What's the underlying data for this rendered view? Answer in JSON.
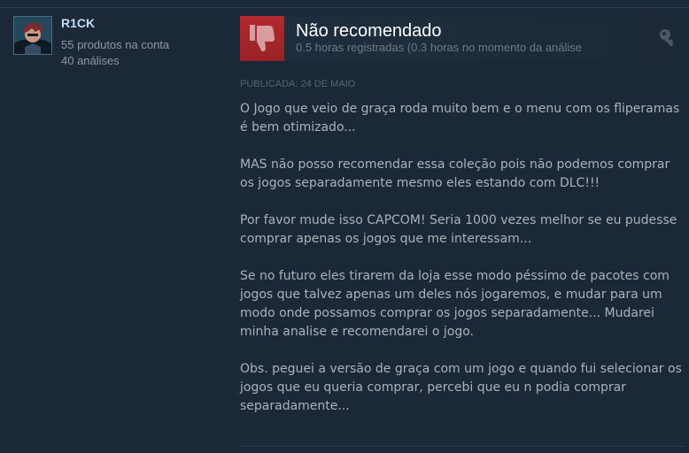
{
  "author": {
    "name": "R1CK",
    "products_owned": "55 produtos na conta",
    "reviews_count": "40 análises",
    "avatar_icon": "user-avatar"
  },
  "review": {
    "vote_title": "Não recomendado",
    "vote_icon": "thumbs-down-icon",
    "vote_color": "#a3262a",
    "hours": "0.5 horas registradas (0.3 horas no momento da análise",
    "key_icon": "key-icon",
    "posted_date": "Publicada: 24 de maio",
    "paragraphs": [
      "O Jogo que veio de graça roda muito bem e o menu com os fliperamas é bem otimizado...",
      "MAS não posso recomendar essa coleção pois não podemos comprar os jogos separadamente mesmo eles estando com DLC!!!",
      "Por favor mude isso CAPCOM! Seria 1000 vezes melhor se eu pudesse comprar apenas os jogos que me interessam...",
      "Se no futuro eles tirarem da loja esse modo péssimo de pacotes com jogos que talvez apenas um deles nós jogaremos, e mudar para um modo onde possamos comprar os jogos separadamente... Mudarei minha analise e recomendarei o jogo.",
      "Obs. peguei a versão de graça com um jogo e quando fui selecionar os jogos que eu queria comprar, percebi que eu n podia comprar separadamente..."
    ]
  },
  "colors": {
    "background": "#1b2838",
    "author_name": "#c1dbf4",
    "body_text": "#acb2b8",
    "muted_text": "#8f98a0"
  }
}
